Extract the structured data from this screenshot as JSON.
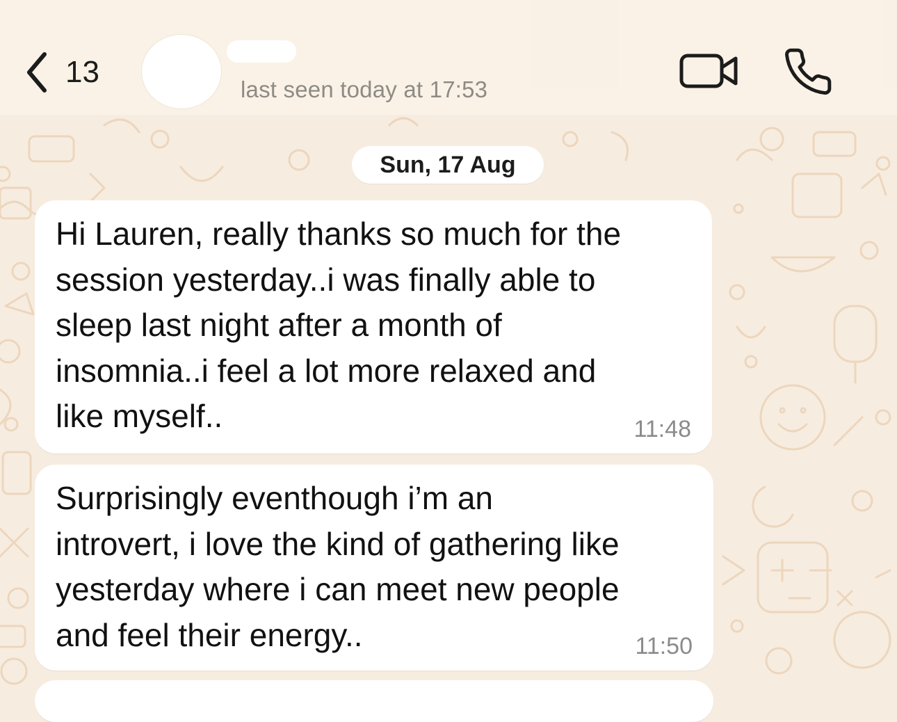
{
  "header": {
    "back_count": "13",
    "contact_status": "last seen today at 17:53",
    "back_icon": "chevron-left-icon",
    "video_icon": "video-camera-icon",
    "call_icon": "phone-icon"
  },
  "date_separator": "Sun, 17 Aug",
  "messages": [
    {
      "text": "Hi Lauren, really thanks so much for the\nsession yesterday..i was finally able to\nsleep last night after a month of\ninsomnia..i feel a lot more relaxed and\nlike myself..",
      "time": "11:48"
    },
    {
      "text": "Surprisingly eventhough i’m an\nintrovert, i love the kind of gathering like\nyesterday where i can meet new people\nand feel their energy..",
      "time": "11:50"
    }
  ],
  "colors": {
    "background": "#f7ece0",
    "doodle": "#ecd6bd",
    "bubble": "#ffffff",
    "status_text": "#8e8a85",
    "timestamp": "#8b8b8b"
  }
}
